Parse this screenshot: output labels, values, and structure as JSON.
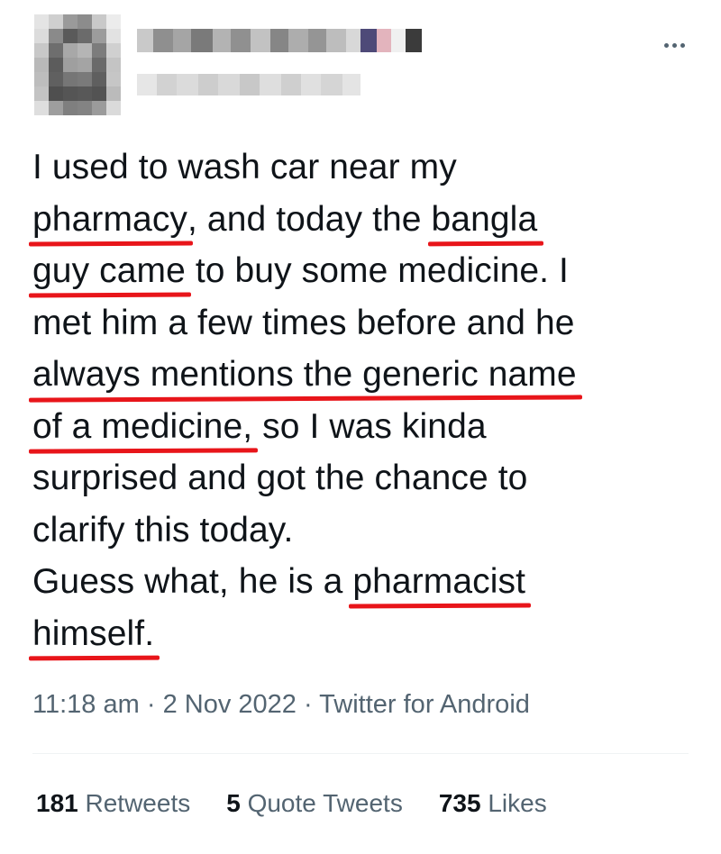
{
  "tweet": {
    "text_lines": [
      [
        "I used to wash car near my"
      ],
      [
        "pharmacy",
        ", and today the ",
        "bangla"
      ],
      [
        "guy came",
        " to buy some medicine. I"
      ],
      [
        "met him a few times before and he"
      ],
      [
        "always mentions the generic name"
      ],
      [
        "of a medicine,",
        " so I was kinda"
      ],
      [
        "surprised and got the chance to"
      ],
      [
        "clarify this today."
      ],
      [
        "Guess what, he is a ",
        "pharmacist "
      ],
      [
        "himself."
      ]
    ],
    "highlighted": [
      "pharmacy",
      "bangla",
      "guy came",
      "always mentions the generic name",
      "of a medicine,",
      "pharmacist ",
      "himself."
    ],
    "time": "11:18 am",
    "date": "2 Nov 2022",
    "separator": "·",
    "source": "Twitter for Android"
  },
  "stats": {
    "retweets_count": "181",
    "retweets_label": "Retweets",
    "quotes_count": "5",
    "quotes_label": "Quote Tweets",
    "likes_count": "735",
    "likes_label": "Likes"
  },
  "colors": {
    "text": "#0f1419",
    "secondary": "#536471",
    "underline": "#e8151a",
    "divider": "#eff3f4"
  },
  "icons": {
    "more": "more-horizontal-icon"
  }
}
